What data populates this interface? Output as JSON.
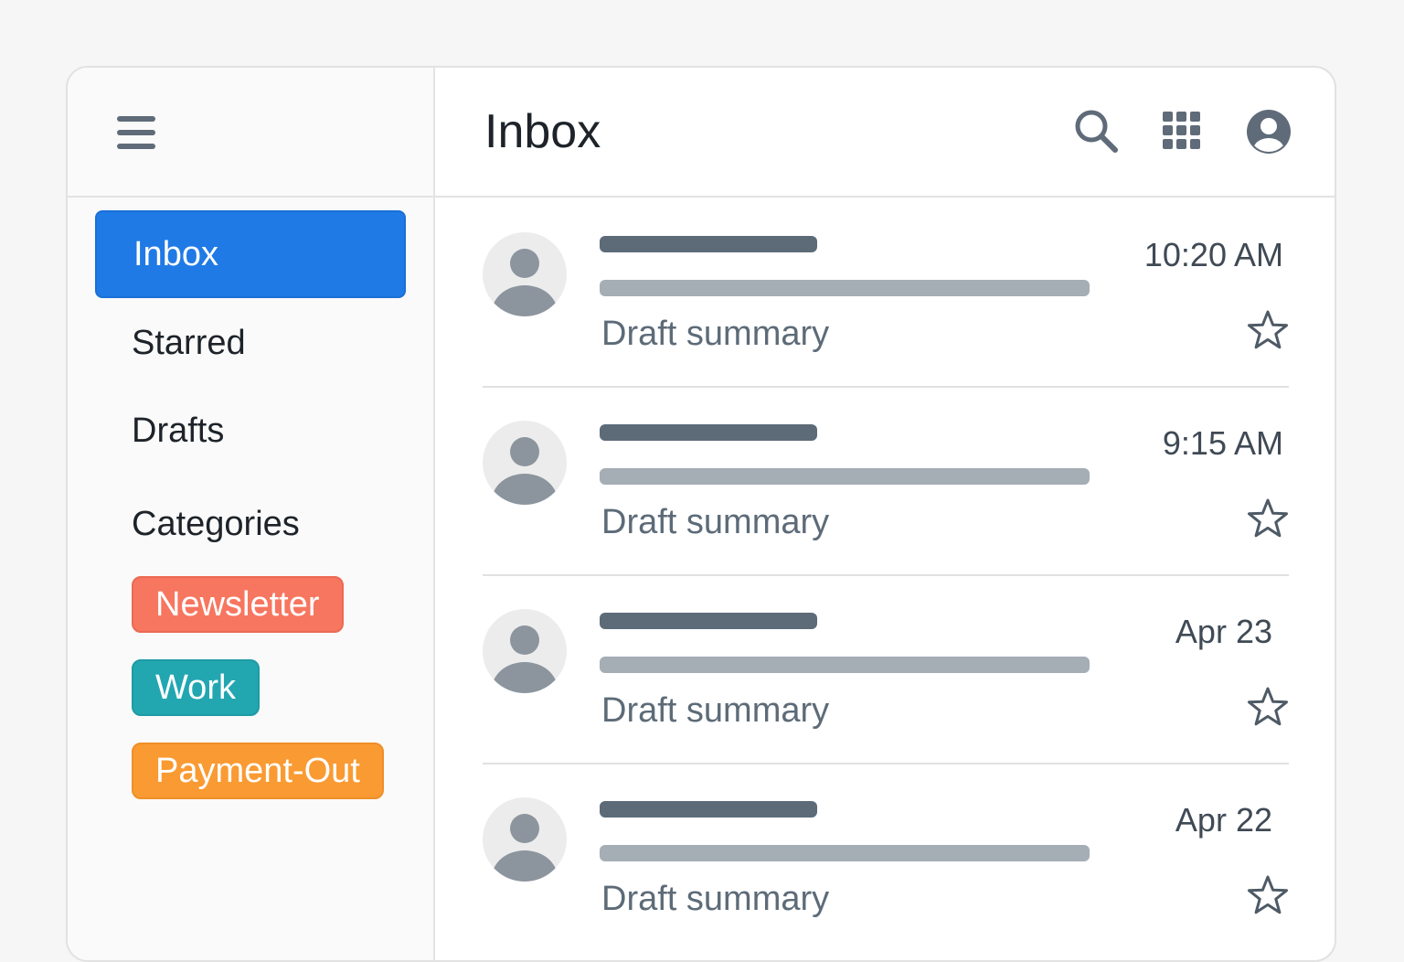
{
  "header": {
    "title": "Inbox",
    "icons": [
      "search-icon",
      "apps-grid-icon",
      "account-icon"
    ]
  },
  "sidebar": {
    "items": [
      {
        "label": "Inbox",
        "active": true
      },
      {
        "label": "Starred",
        "active": false
      },
      {
        "label": "Drafts",
        "active": false
      }
    ],
    "categories_label": "Categories",
    "categories": [
      {
        "label": "Newsletter",
        "color": "#f7765f"
      },
      {
        "label": "Work",
        "color": "#22a7b1"
      },
      {
        "label": "Payment-Out",
        "color": "#fa9a32"
      }
    ]
  },
  "emails": [
    {
      "summary": "Draft summary",
      "time": "10:20 AM",
      "starred": false
    },
    {
      "summary": "Draft summary",
      "time": "9:15 AM",
      "starred": false
    },
    {
      "summary": "Draft summary",
      "time": "Apr 23",
      "starred": false
    },
    {
      "summary": "Draft summary",
      "time": "Apr 22",
      "starred": false
    }
  ],
  "colors": {
    "accent": "#1f7ae6",
    "icon": "#5f6b78"
  }
}
